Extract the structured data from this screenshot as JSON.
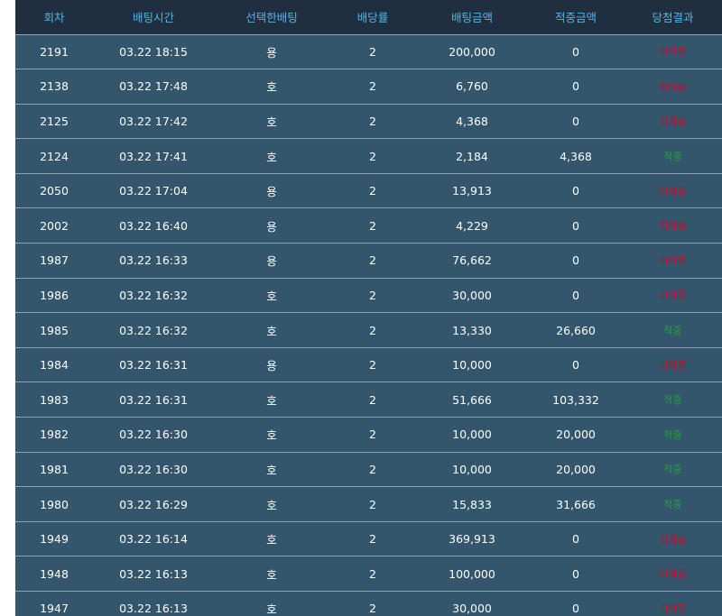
{
  "table": {
    "headers": [
      "회차",
      "배팅시간",
      "선택한배팅",
      "배당률",
      "배팅금액",
      "적중금액",
      "당첨결과"
    ],
    "rows": [
      {
        "round": "2191",
        "time": "03.22 18:15",
        "pick": "용",
        "odds": "2",
        "bet": "200,000",
        "win": "0",
        "result": "미적중",
        "status": "lose"
      },
      {
        "round": "2138",
        "time": "03.22 17:48",
        "pick": "호",
        "odds": "2",
        "bet": "6,760",
        "win": "0",
        "result": "미적중",
        "status": "lose"
      },
      {
        "round": "2125",
        "time": "03.22 17:42",
        "pick": "호",
        "odds": "2",
        "bet": "4,368",
        "win": "0",
        "result": "미적중",
        "status": "lose"
      },
      {
        "round": "2124",
        "time": "03.22 17:41",
        "pick": "호",
        "odds": "2",
        "bet": "2,184",
        "win": "4,368",
        "result": "적중",
        "status": "win"
      },
      {
        "round": "2050",
        "time": "03.22 17:04",
        "pick": "용",
        "odds": "2",
        "bet": "13,913",
        "win": "0",
        "result": "미적중",
        "status": "lose"
      },
      {
        "round": "2002",
        "time": "03.22 16:40",
        "pick": "용",
        "odds": "2",
        "bet": "4,229",
        "win": "0",
        "result": "미적중",
        "status": "lose"
      },
      {
        "round": "1987",
        "time": "03.22 16:33",
        "pick": "용",
        "odds": "2",
        "bet": "76,662",
        "win": "0",
        "result": "미적중",
        "status": "lose"
      },
      {
        "round": "1986",
        "time": "03.22 16:32",
        "pick": "호",
        "odds": "2",
        "bet": "30,000",
        "win": "0",
        "result": "미적중",
        "status": "lose"
      },
      {
        "round": "1985",
        "time": "03.22 16:32",
        "pick": "호",
        "odds": "2",
        "bet": "13,330",
        "win": "26,660",
        "result": "적중",
        "status": "win"
      },
      {
        "round": "1984",
        "time": "03.22 16:31",
        "pick": "용",
        "odds": "2",
        "bet": "10,000",
        "win": "0",
        "result": "미적중",
        "status": "lose"
      },
      {
        "round": "1983",
        "time": "03.22 16:31",
        "pick": "호",
        "odds": "2",
        "bet": "51,666",
        "win": "103,332",
        "result": "적중",
        "status": "win"
      },
      {
        "round": "1982",
        "time": "03.22 16:30",
        "pick": "호",
        "odds": "2",
        "bet": "10,000",
        "win": "20,000",
        "result": "적중",
        "status": "win"
      },
      {
        "round": "1981",
        "time": "03.22 16:30",
        "pick": "호",
        "odds": "2",
        "bet": "10,000",
        "win": "20,000",
        "result": "적중",
        "status": "win"
      },
      {
        "round": "1980",
        "time": "03.22 16:29",
        "pick": "호",
        "odds": "2",
        "bet": "15,833",
        "win": "31,666",
        "result": "적중",
        "status": "win"
      },
      {
        "round": "1949",
        "time": "03.22 16:14",
        "pick": "호",
        "odds": "2",
        "bet": "369,913",
        "win": "0",
        "result": "미적중",
        "status": "lose"
      },
      {
        "round": "1948",
        "time": "03.22 16:13",
        "pick": "호",
        "odds": "2",
        "bet": "100,000",
        "win": "0",
        "result": "미적중",
        "status": "lose"
      },
      {
        "round": "1947",
        "time": "03.22 16:13",
        "pick": "호",
        "odds": "2",
        "bet": "30,000",
        "win": "0",
        "result": "미적중",
        "status": "lose"
      }
    ]
  },
  "colors": {
    "header_bg": "#1f2f40",
    "header_text": "#4fb5ea",
    "row_bg": "#34566c",
    "lose": "#c0102a",
    "win": "#1ea33a"
  }
}
